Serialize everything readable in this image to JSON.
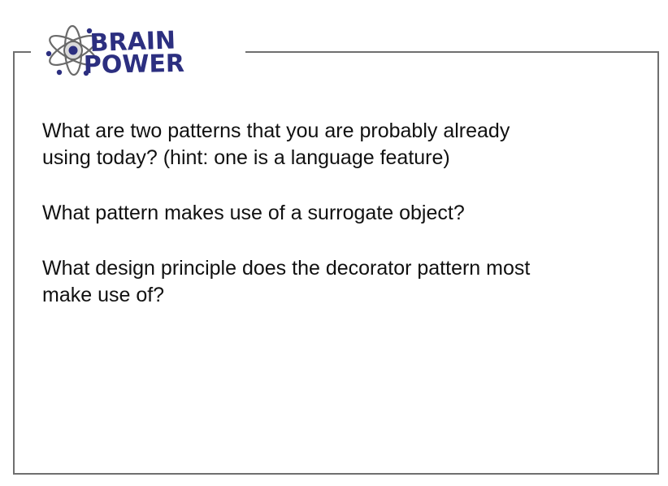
{
  "logo": {
    "line1": "BRAIN",
    "line2": "POWER"
  },
  "questions": [
    "What are two patterns that you are probably already\nusing today? (hint: one is a language feature)",
    "What pattern makes use of a surrogate object?",
    "What design principle does the decorator pattern most\nmake use of?"
  ],
  "colors": {
    "frame": "#6f6f6f",
    "logo": "#2c2f80",
    "text": "#111111",
    "background": "#ffffff"
  }
}
